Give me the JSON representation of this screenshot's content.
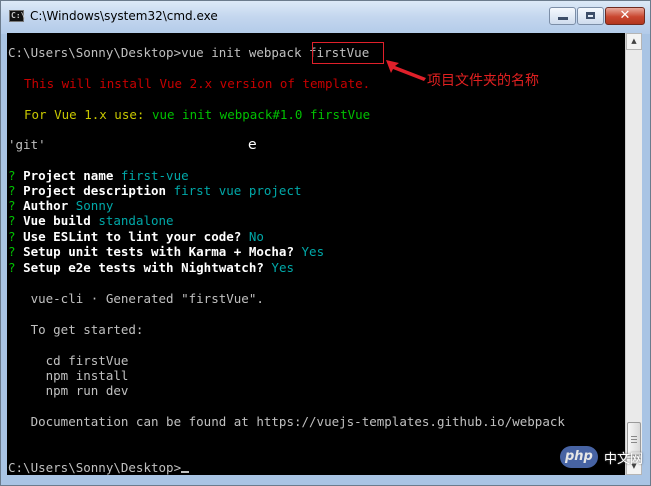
{
  "window": {
    "title": "C:\\Windows\\system32\\cmd.exe",
    "icon_label": "C:\\",
    "controls": {
      "minimize": "minimize",
      "maximize": "maximize",
      "close": "✕"
    }
  },
  "console": {
    "cmd_prompt": "C:\\Users\\Sonny\\Desktop>",
    "cmd_text": "vue init webpack ",
    "cmd_project": "firstVue",
    "warn_line": "This will install Vue 2.x version of template.",
    "v1_label": "For Vue 1.x use: ",
    "v1_cmd": "vue init webpack#1.0 firstVue",
    "git_line": "'git'",
    "stray_char": "e",
    "questions": [
      {
        "q": "? ",
        "label": "Project name ",
        "answer": "first-vue"
      },
      {
        "q": "? ",
        "label": "Project description ",
        "answer": "first vue project"
      },
      {
        "q": "? ",
        "label": "Author ",
        "answer": "Sonny"
      },
      {
        "q": "? ",
        "label": "Vue build ",
        "answer": "standalone"
      },
      {
        "q": "? ",
        "label": "Use ESLint to lint your code? ",
        "answer": "No"
      },
      {
        "q": "? ",
        "label": "Setup unit tests with Karma + Mocha? ",
        "answer": "Yes"
      },
      {
        "q": "? ",
        "label": "Setup e2e tests with Nightwatch? ",
        "answer": "Yes"
      }
    ],
    "generated": "   vue-cli · Generated \"firstVue\".",
    "get_started": "   To get started:",
    "steps": [
      "     cd firstVue",
      "     npm install",
      "     npm run dev"
    ],
    "docs": "   Documentation can be found at https://vuejs-templates.github.io/webpack",
    "final_prompt": "C:\\Users\\Sonny\\Desktop>"
  },
  "annotation": {
    "text": "项目文件夹的名称",
    "color": "#e02020"
  },
  "watermark": {
    "badge": "php",
    "text": "中文网"
  },
  "colors": {
    "console_bg": "#000000",
    "red": "#c80000",
    "yellow": "#c8c800",
    "green": "#00c000",
    "cyan": "#00a8a8"
  }
}
